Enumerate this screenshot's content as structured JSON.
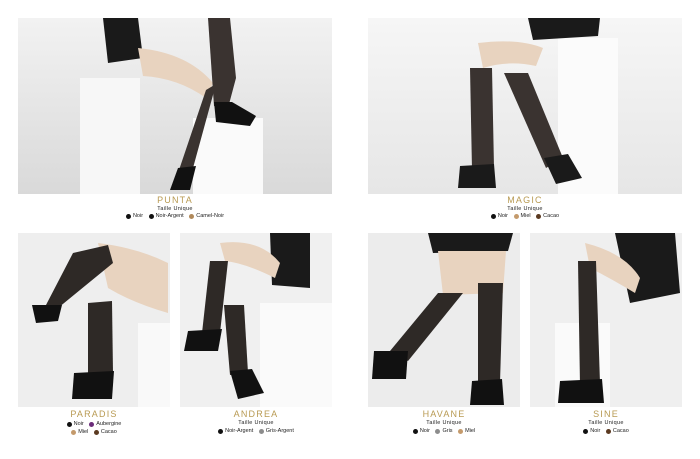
{
  "products": [
    {
      "name": "PUNTA",
      "size": "Taille Unique",
      "colors": [
        {
          "label": "Noir",
          "hex": "#111111"
        },
        {
          "label": "Noir-Argent",
          "hex": "#111111"
        },
        {
          "label": "Camel-Noir",
          "hex": "#b0895a"
        }
      ]
    },
    {
      "name": "MAGIC",
      "size": "Taille Unique",
      "colors": [
        {
          "label": "Noir",
          "hex": "#111111"
        },
        {
          "label": "Miel",
          "hex": "#c49a6c"
        },
        {
          "label": "Cacao",
          "hex": "#5b3a21"
        }
      ]
    },
    {
      "name": "PARADIS",
      "size": "",
      "colors": [
        {
          "label": "Noir",
          "hex": "#111111"
        },
        {
          "label": "Aubergine",
          "hex": "#6b2c7a"
        },
        {
          "label": "Miel",
          "hex": "#c49a6c"
        },
        {
          "label": "Cacao",
          "hex": "#5b3a21"
        }
      ]
    },
    {
      "name": "ANDREA",
      "size": "Taille Unique",
      "colors": [
        {
          "label": "Noir-Argent",
          "hex": "#111111"
        },
        {
          "label": "Gris-Argent",
          "hex": "#8c8c8c"
        }
      ]
    },
    {
      "name": "HAVANE",
      "size": "Taille Unique",
      "colors": [
        {
          "label": "Noir",
          "hex": "#111111"
        },
        {
          "label": "Gris",
          "hex": "#8c8c8c"
        },
        {
          "label": "Miel",
          "hex": "#c49a6c"
        }
      ]
    },
    {
      "name": "SINE",
      "size": "Taille Unique",
      "colors": [
        {
          "label": "Noir",
          "hex": "#111111"
        },
        {
          "label": "Cacao",
          "hex": "#5b3a21"
        }
      ]
    }
  ],
  "palette": {
    "title_color": "#b89a52"
  }
}
